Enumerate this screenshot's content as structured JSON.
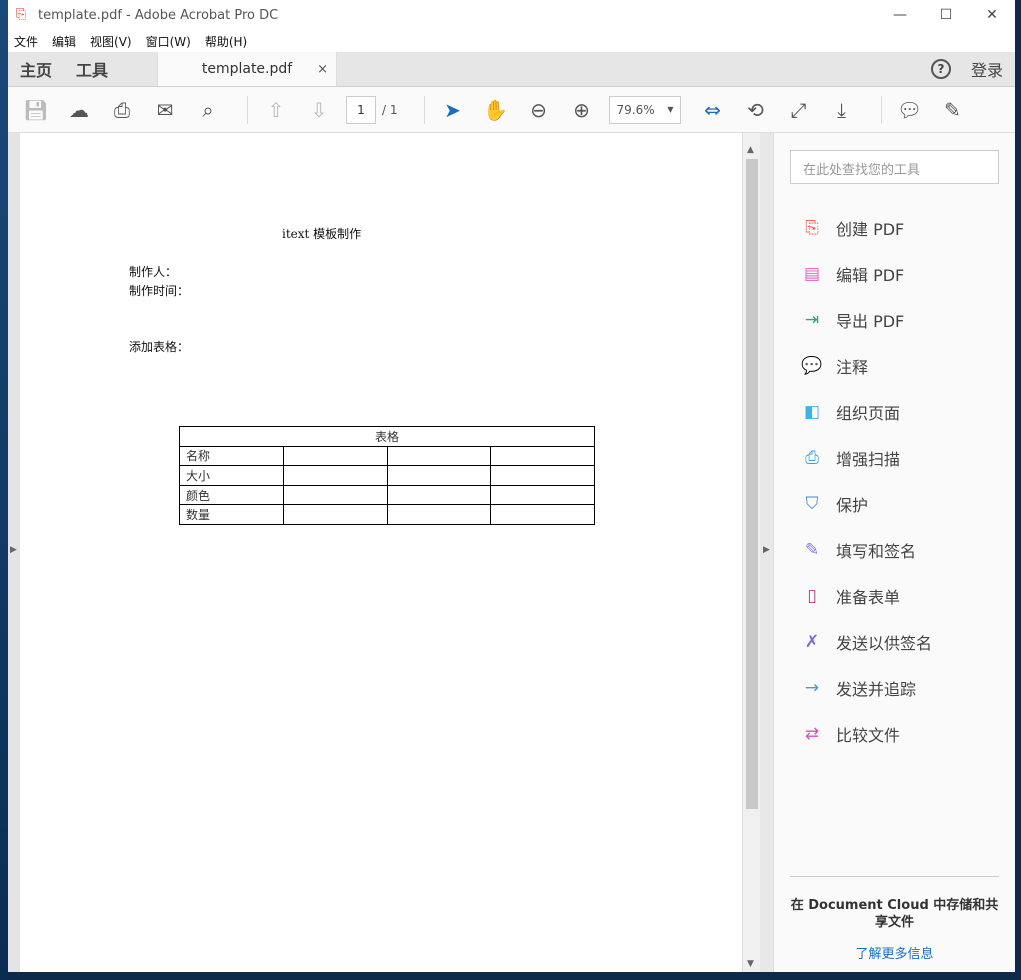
{
  "window": {
    "title": "template.pdf - Adobe Acrobat Pro DC",
    "minimize": "—",
    "maximize": "☐",
    "close": "✕"
  },
  "menu": [
    "文件",
    "编辑",
    "视图(V)",
    "窗口(W)",
    "帮助(H)"
  ],
  "tabs": {
    "home": "主页",
    "tools": "工具",
    "doc_tab": "template.pdf",
    "close": "×",
    "help": "?",
    "login": "登录"
  },
  "toolbar": {
    "page_current": "1",
    "page_total": "/ 1",
    "zoom": "79.6%"
  },
  "document": {
    "title": "itext 模板制作",
    "maker": "制作人：",
    "time": "制作时间：",
    "add_table": "添加表格：",
    "table": {
      "header": "表格",
      "rows": [
        "名称",
        "大小",
        "颜色",
        "数量"
      ]
    }
  },
  "panel": {
    "search_placeholder": "在此处查找您的工具",
    "tools": [
      {
        "label": "创建 PDF",
        "color": "#e8625b",
        "icon": "⎘"
      },
      {
        "label": "编辑 PDF",
        "color": "#e35fbf",
        "icon": "▤"
      },
      {
        "label": "导出 PDF",
        "color": "#2fa77f",
        "icon": "⇥"
      },
      {
        "label": "注释",
        "color": "#f4c22b",
        "icon": "💬"
      },
      {
        "label": "组织页面",
        "color": "#3cb4e5",
        "icon": "◧"
      },
      {
        "label": "增强扫描",
        "color": "#3da0d8",
        "icon": "⎙"
      },
      {
        "label": "保护",
        "color": "#4a86c8",
        "icon": "⛉"
      },
      {
        "label": "填写和签名",
        "color": "#8e76d8",
        "icon": "✎"
      },
      {
        "label": "准备表单",
        "color": "#b1398c",
        "icon": "▯"
      },
      {
        "label": "发送以供签名",
        "color": "#7b68d8",
        "icon": "✗"
      },
      {
        "label": "发送并追踪",
        "color": "#3aa0d8",
        "icon": "→"
      },
      {
        "label": "比较文件",
        "color": "#d64fc8",
        "icon": "⇄"
      }
    ],
    "footer_text": "在 Document Cloud 中存储和共享文件",
    "footer_link": "了解更多信息"
  }
}
